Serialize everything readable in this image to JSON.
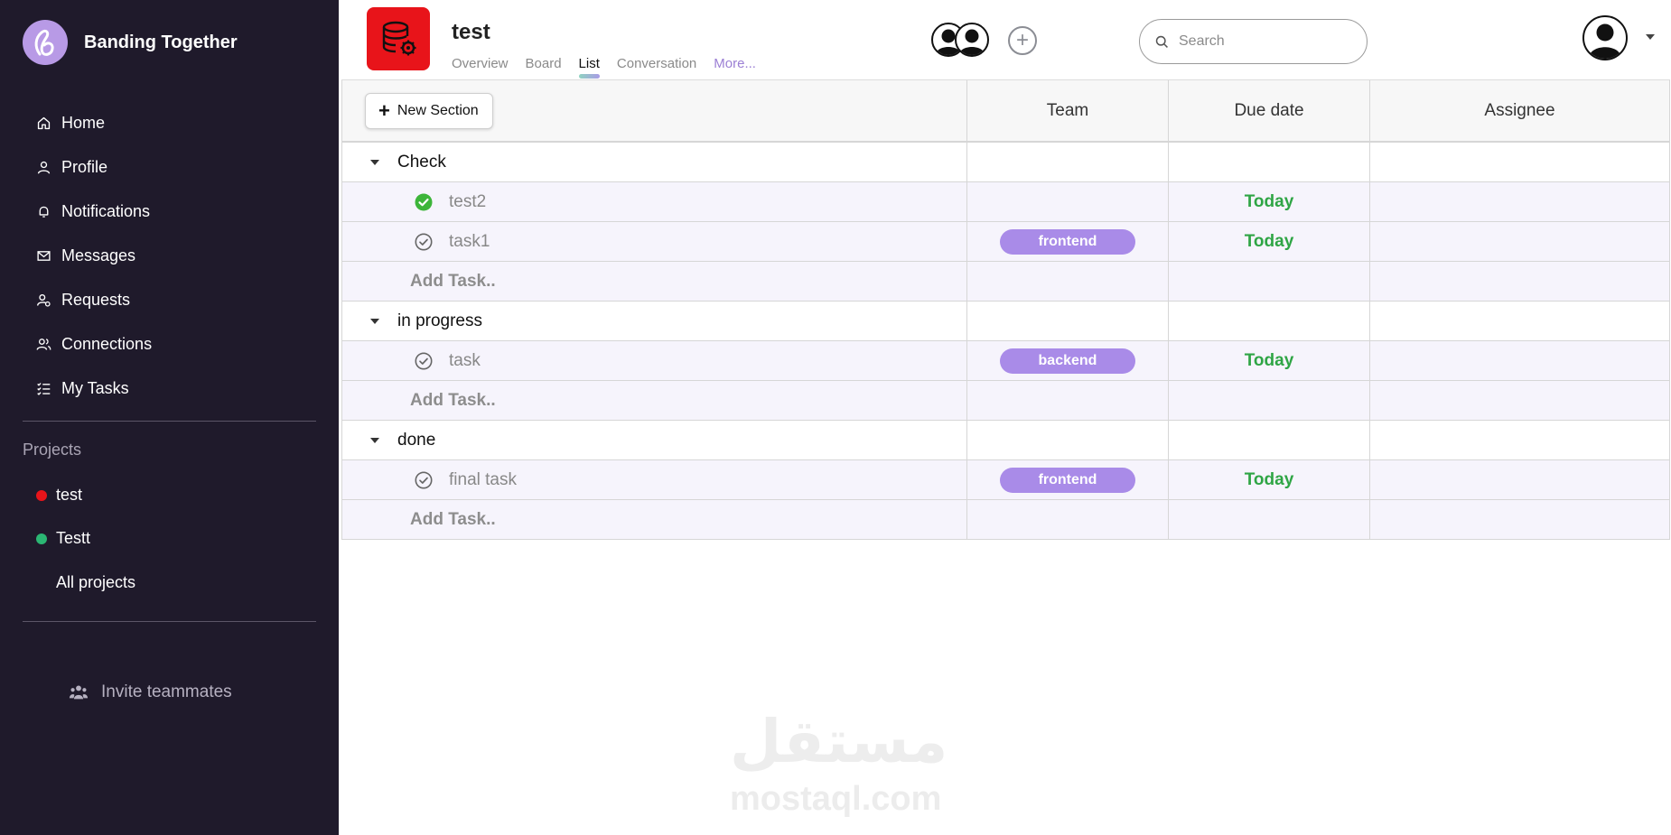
{
  "app": {
    "name": "Banding Together"
  },
  "sidebar": {
    "nav": [
      {
        "label": "Home",
        "icon": "home-icon"
      },
      {
        "label": "Profile",
        "icon": "user-icon"
      },
      {
        "label": "Notifications",
        "icon": "bell-icon"
      },
      {
        "label": "Messages",
        "icon": "mail-icon"
      },
      {
        "label": "Requests",
        "icon": "user-request-icon"
      },
      {
        "label": "Connections",
        "icon": "users-icon"
      },
      {
        "label": "My Tasks",
        "icon": "tasks-list-icon"
      }
    ],
    "projects_title": "Projects",
    "projects": [
      {
        "label": "test",
        "color": "#e8141a"
      },
      {
        "label": "Testt",
        "color": "#2bb673"
      }
    ],
    "all_projects": "All projects",
    "invite": "Invite teammates"
  },
  "header": {
    "project_title": "test",
    "tabs": [
      "Overview",
      "Board",
      "List",
      "Conversation",
      "More..."
    ],
    "active_tab": "List",
    "search_placeholder": "Search"
  },
  "table": {
    "new_section": "New Section",
    "columns": [
      "Team",
      "Due date",
      "Assignee"
    ],
    "add_task_label": "Add Task..",
    "sections": [
      {
        "name": "Check",
        "tasks": [
          {
            "name": "test2",
            "done": true,
            "team": "",
            "due": "Today"
          },
          {
            "name": "task1",
            "done": false,
            "team": "frontend",
            "due": "Today"
          }
        ]
      },
      {
        "name": "in progress",
        "tasks": [
          {
            "name": "task",
            "done": false,
            "team": "backend",
            "due": "Today"
          }
        ]
      },
      {
        "name": "done",
        "tasks": [
          {
            "name": "final task",
            "done": false,
            "team": "frontend",
            "due": "Today"
          }
        ]
      }
    ]
  },
  "colors": {
    "sidebar_bg": "#1f1a2b",
    "accent": "#a98be8",
    "due_green": "#2fa545",
    "project_red": "#e8141a"
  },
  "watermark": {
    "arabic": "مستقل",
    "latin": "mostaql.com"
  }
}
